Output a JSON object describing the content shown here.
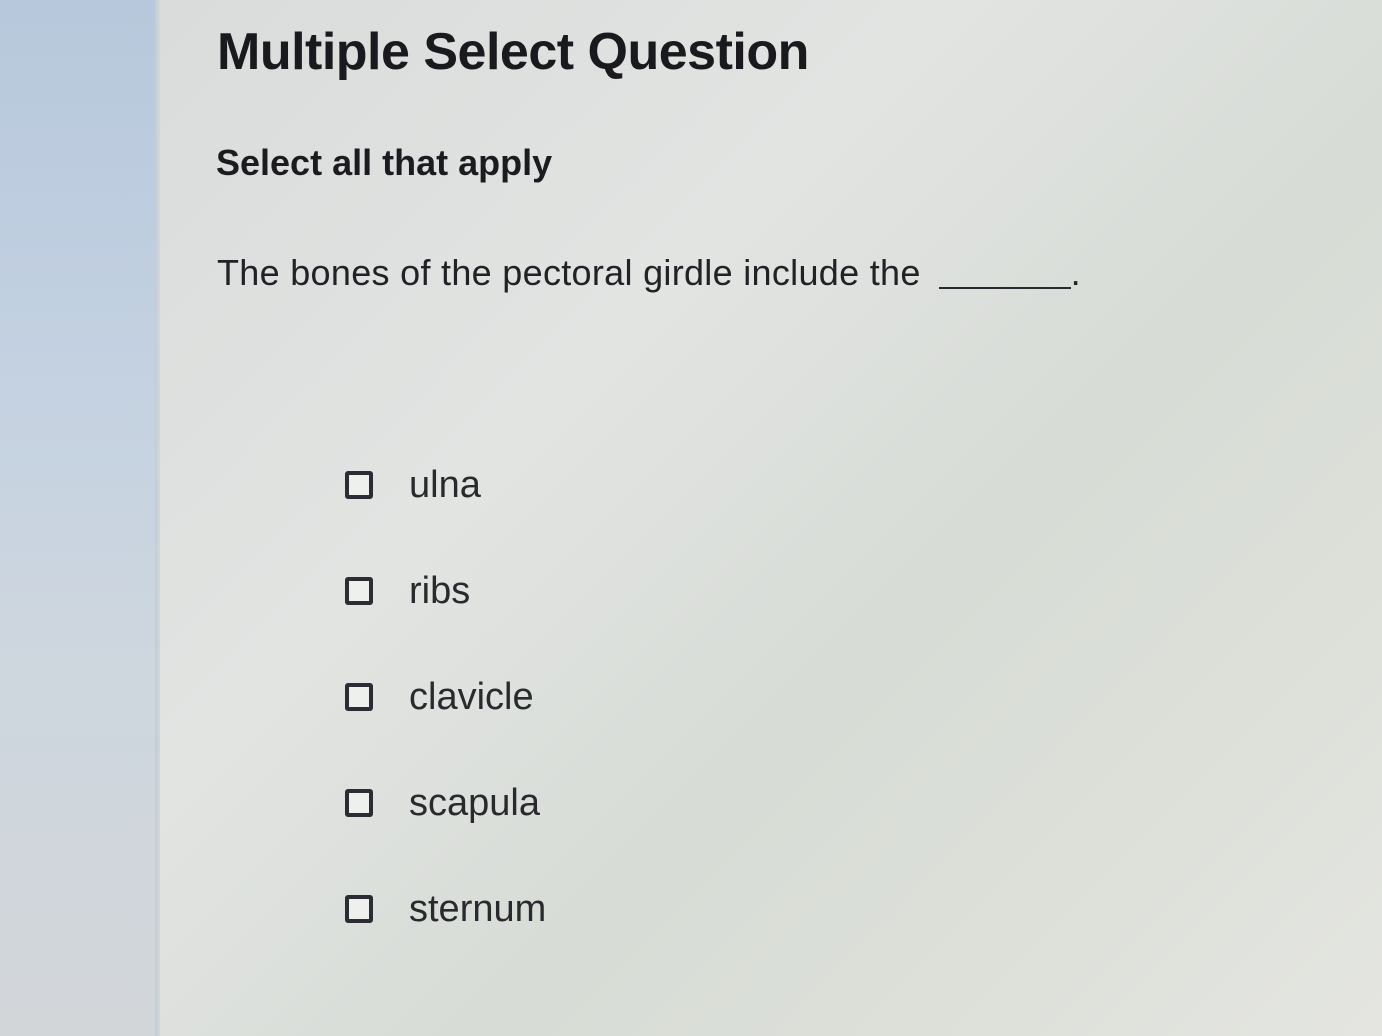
{
  "question": {
    "type_title": "Multiple Select Question",
    "instruction": "Select all that apply",
    "prompt_text": "The bones of the pectoral girdle include the",
    "prompt_end": "."
  },
  "options": [
    {
      "label": "ulna",
      "checked": false
    },
    {
      "label": "ribs",
      "checked": false
    },
    {
      "label": "clavicle",
      "checked": false
    },
    {
      "label": "scapula",
      "checked": false
    },
    {
      "label": "sternum",
      "checked": false
    }
  ]
}
